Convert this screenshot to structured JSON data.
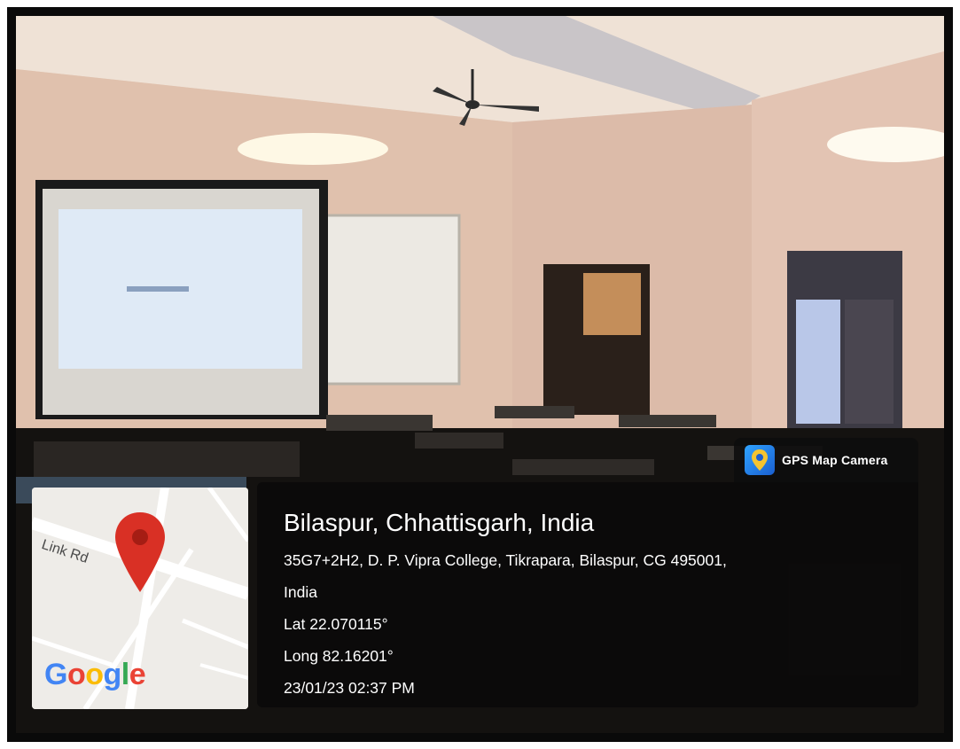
{
  "overlay": {
    "app_badge": "GPS Map Camera",
    "location_title": "Bilaspur, Chhattisgarh, India",
    "address_line1": "35G7+2H2, D. P. Vipra College, Tikrapara, Bilaspur, CG 495001,",
    "address_line2": "India",
    "latitude": "Lat 22.070115°",
    "longitude": "Long 82.16201°",
    "timestamp": "23/01/23 02:37 PM"
  },
  "map": {
    "road_label": "Link Rd",
    "brand": "Google",
    "pin_color": "#d93025"
  },
  "colors": {
    "panel_background": "#0a0a0a",
    "text": "#ffffff",
    "badge_icon": "#1a73e8"
  }
}
